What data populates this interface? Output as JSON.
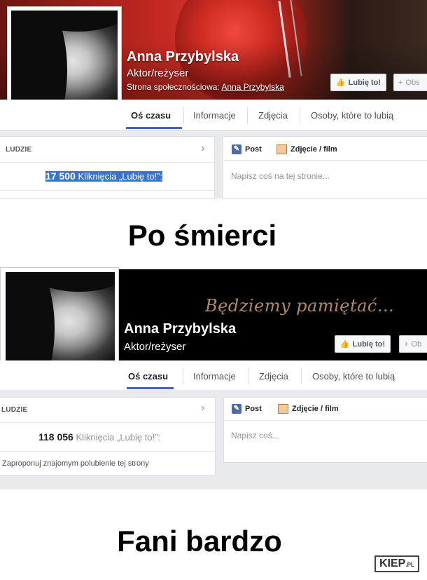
{
  "top": {
    "name": "Anna Przybylska",
    "role": "Aktor/reżyser",
    "community_prefix": "Strona społecznościowa:",
    "community_link": "Anna Przybylska",
    "like_button": "Lubię to!",
    "follow_button": "Obs",
    "tabs": [
      "Oś czasu",
      "Informacje",
      "Zdjęcia",
      "Osoby, które to lubią"
    ],
    "people_header": "LUDZIE",
    "likes_count": "17 500",
    "likes_label": "Kliknięcia „Lubię to!”:",
    "composer_post": "Post",
    "composer_photo": "Zdjęcie / film",
    "composer_placeholder": "Napisz coś na tej stronie..."
  },
  "caption_top": "Po śmierci",
  "bottom": {
    "cover_text": "Będziemy pamiętać...",
    "name": "Anna Przybylska",
    "role": "Aktor/reżyser",
    "like_button": "Lubię to!",
    "follow_button": "Ob",
    "tabs": [
      "Oś czasu",
      "Informacje",
      "Zdjęcia",
      "Osoby, które to lubią"
    ],
    "people_header": "LUDZIE",
    "likes_count": "118 056",
    "likes_label": "Kliknięcia „Lubię to!”:",
    "suggest_text": "Zaproponuj znajomym polubienie tej strony",
    "composer_post": "Post",
    "composer_photo": "Zdjęcie / film",
    "composer_placeholder": "Napisz coś..."
  },
  "caption_bottom": "Fani bardzo",
  "watermark": {
    "main": "KIEP",
    "suffix": ".PL"
  },
  "colors": {
    "facebook_blue": "#4267b2",
    "highlight": "#3874cb",
    "cover_red": "#d9322a",
    "script_gold": "#b08a63"
  }
}
